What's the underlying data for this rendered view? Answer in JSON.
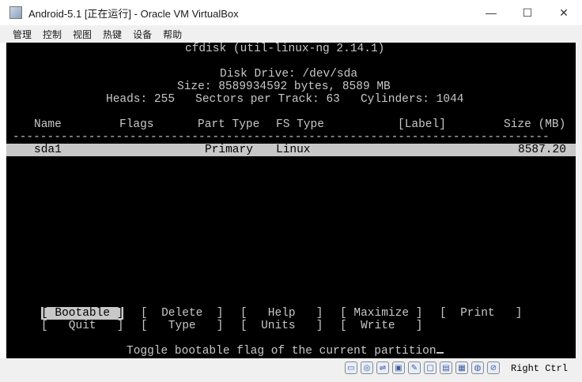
{
  "window": {
    "title": "Android-5.1 [正在运行] - Oracle VM VirtualBox",
    "minimize": "—",
    "maximize": "☐",
    "close": "✕"
  },
  "menu": [
    "管理",
    "控制",
    "视图",
    "热键",
    "设备",
    "帮助"
  ],
  "cfdisk": {
    "program": "cfdisk (util-linux-ng 2.14.1)",
    "disk_drive": "Disk Drive: /dev/sda",
    "size": "Size: 8589934592 bytes, 8589 MB",
    "geometry": "Heads: 255   Sectors per Track: 63   Cylinders: 1044",
    "columns": {
      "name": "Name",
      "flags": "Flags",
      "part_type": "Part Type",
      "fs_type": "FS Type",
      "label": "[Label]",
      "size": "Size (MB)"
    },
    "separator": "------------------------------------------------------------------------------",
    "rows": [
      {
        "name": "sda1",
        "flags": "",
        "part_type": "Primary",
        "fs_type": "Linux",
        "label": "",
        "size": "8587.20"
      }
    ],
    "buttons_row1": {
      "bootable": "[ Bootable ]",
      "delete": "[  Delete  ]",
      "help": "[   Help   ]",
      "maximize": "[ Maximize ]",
      "print": "[  Print   ]"
    },
    "buttons_row2": {
      "quit": "[   Quit   ]",
      "type": "[   Type   ]",
      "units": "[  Units   ]",
      "write": "[  Write   ]"
    },
    "status": "Toggle bootable flag of the current partition"
  },
  "statusbar": {
    "icons": [
      "hard-disk-icon",
      "optical-disk-icon",
      "usb-icon",
      "shared-folder-icon",
      "display-icon",
      "network-icon",
      "recording-icon",
      "cpu-icon",
      "mouse-integration-icon",
      "keyboard-icon"
    ],
    "host_key": "Right Ctrl"
  }
}
